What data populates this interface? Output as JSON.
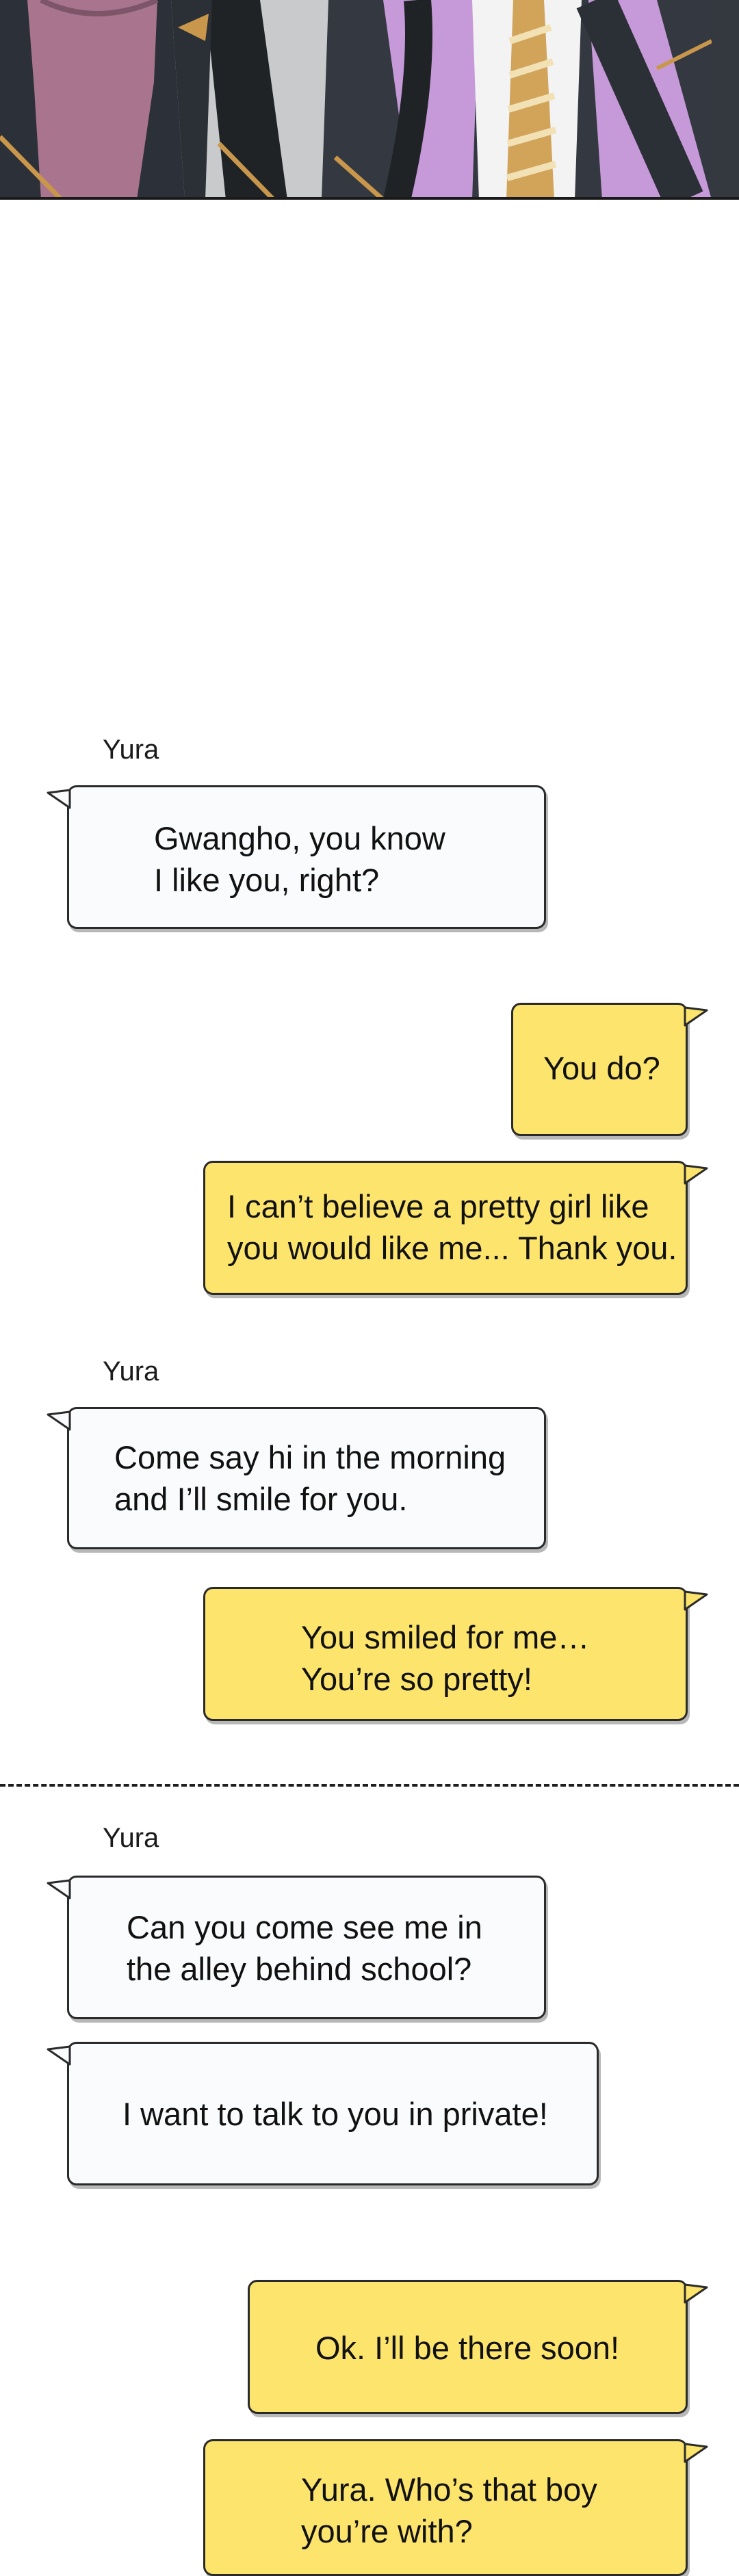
{
  "colors": {
    "incoming_bubble": "#fafbfc",
    "outgoing_bubble": "#fde56d",
    "bubble_border": "#2a2a2a"
  },
  "messages": [
    {
      "sender": "Yura",
      "text": "Gwangho, you know\nI like you, right?",
      "direction": "in"
    },
    {
      "text": "You do?",
      "direction": "out"
    },
    {
      "text": "I can’t believe a pretty girl like\nyou would like me... Thank you.",
      "direction": "out"
    },
    {
      "sender": "Yura",
      "text": "Come say hi in the morning\nand I’ll smile for you.",
      "direction": "in"
    },
    {
      "text": "You smiled for me…\nYou’re so pretty!",
      "direction": "out"
    },
    {
      "sender": "Yura",
      "text": "Can you come see me in\nthe alley behind school?",
      "direction": "in"
    },
    {
      "text": "I want to talk to you in private!",
      "direction": "in"
    },
    {
      "text": "Ok. I’ll be there soon!",
      "direction": "out"
    },
    {
      "text": "Yura. Who’s that boy\nyou’re with?",
      "direction": "out"
    }
  ]
}
